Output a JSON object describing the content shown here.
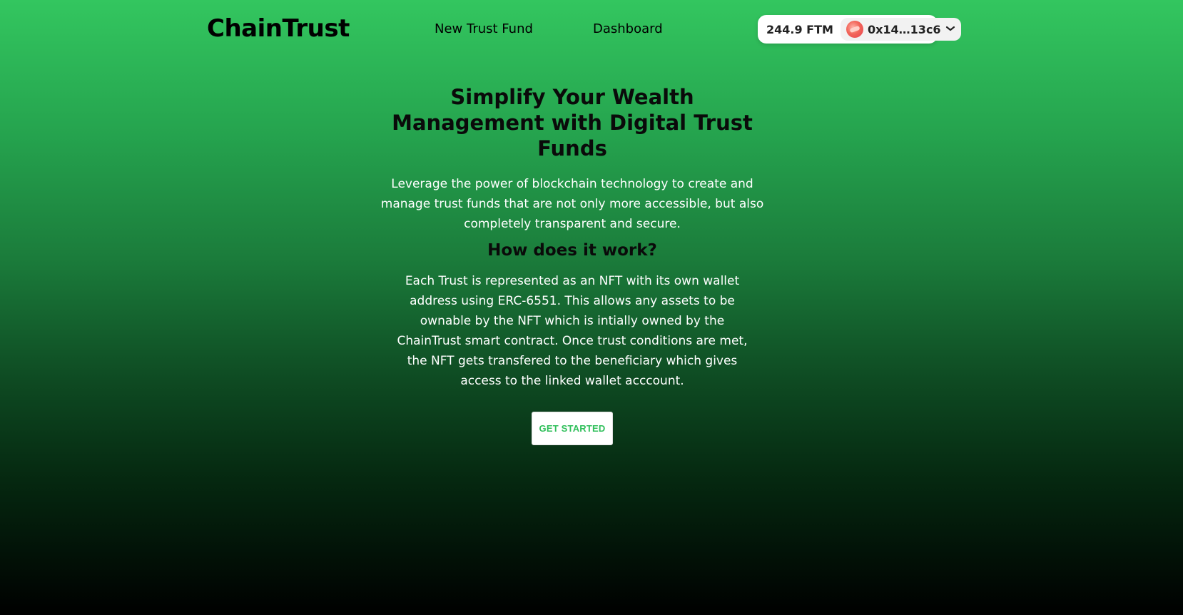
{
  "navbar": {
    "logo": "ChainTrust",
    "links": [
      {
        "label": "New Trust Fund"
      },
      {
        "label": "Dashboard"
      }
    ],
    "wallet": {
      "balance": "244.9 FTM",
      "address": "0x14…13c6",
      "chevron": "❯"
    }
  },
  "hero": {
    "title": "Simplify Your Wealth Management with Digital Trust Funds",
    "subtitle": "Leverage the power of blockchain technology to create and manage trust funds that are not only more accessible, but also completely transparent and secure."
  },
  "how": {
    "title": "How does it work?",
    "text": "Each Trust is represented as an NFT with its own wallet address using ERC-6551. This allows any assets to be ownable by the NFT which is intially owned by the ChainTrust smart contract. Once trust conditions are met, the NFT gets transfered to the beneficiary which gives access to the linked wallet acccount."
  },
  "cta": {
    "label": "GET STARTED"
  },
  "colors": {
    "accent": "#2fbf5a",
    "background_top": "#33c65f",
    "background_bottom": "#000000"
  },
  "icons": {
    "avatar": "avatar-icon",
    "chevron": "chevron-down-icon"
  }
}
